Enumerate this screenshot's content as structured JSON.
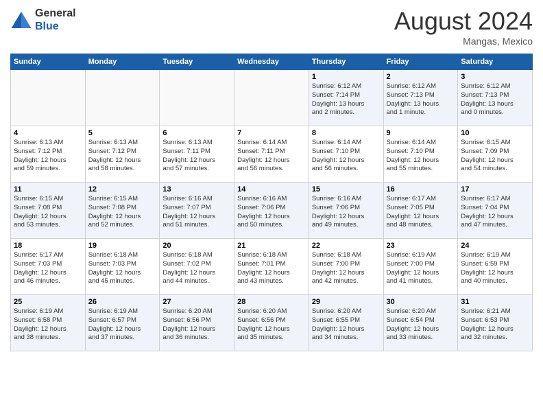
{
  "header": {
    "logo_line1": "General",
    "logo_line2": "Blue",
    "month_year": "August 2024",
    "location": "Mangas, Mexico"
  },
  "weekdays": [
    "Sunday",
    "Monday",
    "Tuesday",
    "Wednesday",
    "Thursday",
    "Friday",
    "Saturday"
  ],
  "weeks": [
    [
      {
        "day": "",
        "info": ""
      },
      {
        "day": "",
        "info": ""
      },
      {
        "day": "",
        "info": ""
      },
      {
        "day": "",
        "info": ""
      },
      {
        "day": "1",
        "info": "Sunrise: 6:12 AM\nSunset: 7:14 PM\nDaylight: 13 hours\nand 2 minutes."
      },
      {
        "day": "2",
        "info": "Sunrise: 6:12 AM\nSunset: 7:13 PM\nDaylight: 13 hours\nand 1 minute."
      },
      {
        "day": "3",
        "info": "Sunrise: 6:12 AM\nSunset: 7:13 PM\nDaylight: 13 hours\nand 0 minutes."
      }
    ],
    [
      {
        "day": "4",
        "info": "Sunrise: 6:13 AM\nSunset: 7:12 PM\nDaylight: 12 hours\nand 59 minutes."
      },
      {
        "day": "5",
        "info": "Sunrise: 6:13 AM\nSunset: 7:12 PM\nDaylight: 12 hours\nand 58 minutes."
      },
      {
        "day": "6",
        "info": "Sunrise: 6:13 AM\nSunset: 7:11 PM\nDaylight: 12 hours\nand 57 minutes."
      },
      {
        "day": "7",
        "info": "Sunrise: 6:14 AM\nSunset: 7:11 PM\nDaylight: 12 hours\nand 56 minutes."
      },
      {
        "day": "8",
        "info": "Sunrise: 6:14 AM\nSunset: 7:10 PM\nDaylight: 12 hours\nand 56 minutes."
      },
      {
        "day": "9",
        "info": "Sunrise: 6:14 AM\nSunset: 7:10 PM\nDaylight: 12 hours\nand 55 minutes."
      },
      {
        "day": "10",
        "info": "Sunrise: 6:15 AM\nSunset: 7:09 PM\nDaylight: 12 hours\nand 54 minutes."
      }
    ],
    [
      {
        "day": "11",
        "info": "Sunrise: 6:15 AM\nSunset: 7:08 PM\nDaylight: 12 hours\nand 53 minutes."
      },
      {
        "day": "12",
        "info": "Sunrise: 6:15 AM\nSunset: 7:08 PM\nDaylight: 12 hours\nand 52 minutes."
      },
      {
        "day": "13",
        "info": "Sunrise: 6:16 AM\nSunset: 7:07 PM\nDaylight: 12 hours\nand 51 minutes."
      },
      {
        "day": "14",
        "info": "Sunrise: 6:16 AM\nSunset: 7:06 PM\nDaylight: 12 hours\nand 50 minutes."
      },
      {
        "day": "15",
        "info": "Sunrise: 6:16 AM\nSunset: 7:06 PM\nDaylight: 12 hours\nand 49 minutes."
      },
      {
        "day": "16",
        "info": "Sunrise: 6:17 AM\nSunset: 7:05 PM\nDaylight: 12 hours\nand 48 minutes."
      },
      {
        "day": "17",
        "info": "Sunrise: 6:17 AM\nSunset: 7:04 PM\nDaylight: 12 hours\nand 47 minutes."
      }
    ],
    [
      {
        "day": "18",
        "info": "Sunrise: 6:17 AM\nSunset: 7:03 PM\nDaylight: 12 hours\nand 46 minutes."
      },
      {
        "day": "19",
        "info": "Sunrise: 6:18 AM\nSunset: 7:03 PM\nDaylight: 12 hours\nand 45 minutes."
      },
      {
        "day": "20",
        "info": "Sunrise: 6:18 AM\nSunset: 7:02 PM\nDaylight: 12 hours\nand 44 minutes."
      },
      {
        "day": "21",
        "info": "Sunrise: 6:18 AM\nSunset: 7:01 PM\nDaylight: 12 hours\nand 43 minutes."
      },
      {
        "day": "22",
        "info": "Sunrise: 6:18 AM\nSunset: 7:00 PM\nDaylight: 12 hours\nand 42 minutes."
      },
      {
        "day": "23",
        "info": "Sunrise: 6:19 AM\nSunset: 7:00 PM\nDaylight: 12 hours\nand 41 minutes."
      },
      {
        "day": "24",
        "info": "Sunrise: 6:19 AM\nSunset: 6:59 PM\nDaylight: 12 hours\nand 40 minutes."
      }
    ],
    [
      {
        "day": "25",
        "info": "Sunrise: 6:19 AM\nSunset: 6:58 PM\nDaylight: 12 hours\nand 38 minutes."
      },
      {
        "day": "26",
        "info": "Sunrise: 6:19 AM\nSunset: 6:57 PM\nDaylight: 12 hours\nand 37 minutes."
      },
      {
        "day": "27",
        "info": "Sunrise: 6:20 AM\nSunset: 6:56 PM\nDaylight: 12 hours\nand 36 minutes."
      },
      {
        "day": "28",
        "info": "Sunrise: 6:20 AM\nSunset: 6:56 PM\nDaylight: 12 hours\nand 35 minutes."
      },
      {
        "day": "29",
        "info": "Sunrise: 6:20 AM\nSunset: 6:55 PM\nDaylight: 12 hours\nand 34 minutes."
      },
      {
        "day": "30",
        "info": "Sunrise: 6:20 AM\nSunset: 6:54 PM\nDaylight: 12 hours\nand 33 minutes."
      },
      {
        "day": "31",
        "info": "Sunrise: 6:21 AM\nSunset: 6:53 PM\nDaylight: 12 hours\nand 32 minutes."
      }
    ]
  ]
}
